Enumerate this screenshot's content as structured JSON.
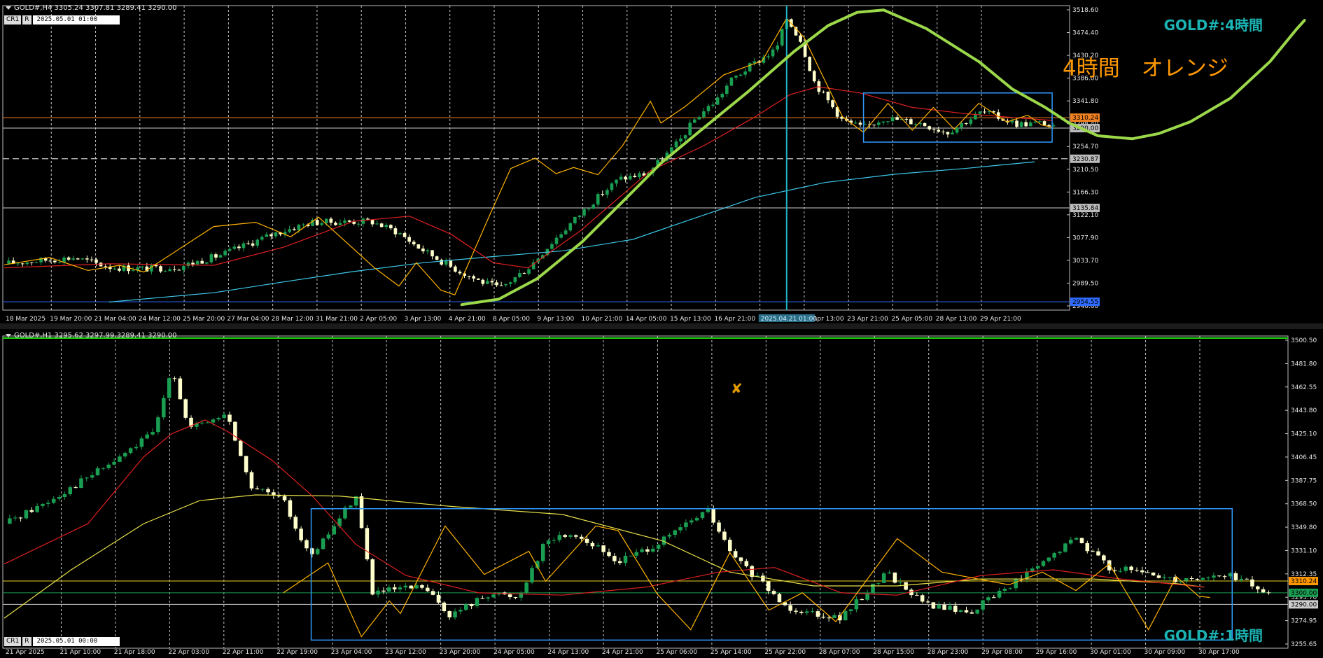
{
  "top": {
    "header": "GOLD#,H4  3305.24 3307.81 3289.41 3290.00",
    "mode": {
      "cr": "CR1",
      "r": "R",
      "date": "2025.05.01 01:00"
    },
    "panel_title": "GOLD#:4時間",
    "annotation": "4時間　オレンジ",
    "cursor_label": "2025.04.21 01:00"
  },
  "bottom": {
    "header": "GOLD#,H1  3295.62 3297.99 3289.41 3290.00",
    "mode": {
      "cr": "CR1",
      "r": "R",
      "date": "2025.05.01 00:00"
    },
    "panel_title": "GOLD#:1時間"
  },
  "colors": {
    "bull": "#1a9e52",
    "bear": "#ffffcc",
    "ma_red": "#e02020",
    "ma_cyan": "#3dc8ea",
    "ma_yellow": "#e9e14a",
    "zigzag": "#ffb300",
    "box": "#2f9bff",
    "curve": "#9bd84a",
    "cursor": "#20b4c8"
  },
  "chart_data": [
    {
      "type": "candlestick",
      "title": "GOLD#,H4",
      "ylim": [
        2946.6,
        3518.6
      ],
      "y_ticks": [
        "3518.60",
        "3474.40",
        "3430.20",
        "3386.00",
        "3341.80",
        "3298.40",
        "3254.70",
        "3210.50",
        "3166.30",
        "3122.10",
        "3077.90",
        "3033.70",
        "2989.50",
        "2946.60"
      ],
      "x_ticks": [
        "18 Mar 2025",
        "19 Mar 20:00",
        "21 Mar 04:00",
        "24 Mar 12:00",
        "25 Mar 20:00",
        "27 Mar 04:00",
        "28 Mar 12:00",
        "31 Mar 21:00",
        "2 Apr 05:00",
        "3 Apr 13:00",
        "4 Apr 21:00",
        "8 Apr 05:00",
        "9 Apr 13:00",
        "10 Apr 21:00",
        "14 Apr 05:00",
        "15 Apr 13:00",
        "16 Apr 21:00",
        "05:00",
        "22 Apr 13:00",
        "23 Apr 21:00",
        "25 Apr 05:00",
        "28 Apr 13:00",
        "29 Apr 21:00"
      ],
      "bars": 228,
      "price_path": [
        [
          0,
          3028
        ],
        [
          20,
          3040
        ],
        [
          30,
          3022
        ],
        [
          40,
          3018
        ],
        [
          50,
          3022
        ],
        [
          62,
          3045
        ],
        [
          78,
          3088
        ],
        [
          88,
          3108
        ],
        [
          105,
          3110
        ],
        [
          113,
          3088
        ],
        [
          118,
          3062
        ],
        [
          128,
          3022
        ],
        [
          136,
          2995
        ],
        [
          142,
          2980
        ],
        [
          150,
          3020
        ],
        [
          158,
          3078
        ],
        [
          168,
          3145
        ],
        [
          176,
          3192
        ],
        [
          184,
          3202
        ],
        [
          193,
          3262
        ],
        [
          198,
          3310
        ],
        [
          204,
          3345
        ],
        [
          208,
          3382
        ],
        [
          214,
          3412
        ],
        [
          221,
          3442
        ],
        [
          224,
          3502
        ],
        [
          228,
          3460
        ],
        [
          232,
          3378
        ],
        [
          240,
          3305
        ],
        [
          246,
          3290
        ],
        [
          252,
          3310
        ],
        [
          262,
          3300
        ],
        [
          270,
          3282
        ],
        [
          280,
          3322
        ],
        [
          290,
          3298
        ],
        [
          298,
          3300
        ],
        [
          300,
          3290
        ]
      ],
      "zigzag": [
        [
          0,
          3026
        ],
        [
          13,
          3040
        ],
        [
          24,
          3015
        ],
        [
          33,
          3025
        ],
        [
          40,
          3012
        ],
        [
          60,
          3100
        ],
        [
          72,
          3108
        ],
        [
          82,
          3080
        ],
        [
          90,
          3118
        ],
        [
          106,
          3020
        ],
        [
          113,
          2985
        ],
        [
          118,
          3030
        ],
        [
          125,
          2977
        ],
        [
          129,
          2968
        ],
        [
          139,
          3122
        ],
        [
          145,
          3212
        ],
        [
          152,
          3232
        ],
        [
          158,
          3202
        ],
        [
          163,
          3214
        ],
        [
          170,
          3200
        ],
        [
          177,
          3256
        ],
        [
          185,
          3342
        ],
        [
          188,
          3300
        ],
        [
          195,
          3332
        ],
        [
          206,
          3393
        ],
        [
          217,
          3420
        ],
        [
          224,
          3502
        ],
        [
          229,
          3465
        ],
        [
          240,
          3312
        ],
        [
          246,
          3282
        ],
        [
          253,
          3338
        ],
        [
          260,
          3286
        ],
        [
          266,
          3330
        ],
        [
          272,
          3288
        ],
        [
          279,
          3338
        ],
        [
          287,
          3302
        ],
        [
          293,
          3315
        ],
        [
          297,
          3296
        ],
        [
          300,
          3292
        ]
      ],
      "ma_red": [
        [
          0,
          3020
        ],
        [
          30,
          3028
        ],
        [
          60,
          3025
        ],
        [
          80,
          3060
        ],
        [
          100,
          3110
        ],
        [
          116,
          3120
        ],
        [
          128,
          3085
        ],
        [
          140,
          3030
        ],
        [
          150,
          3020
        ],
        [
          165,
          3092
        ],
        [
          185,
          3208
        ],
        [
          200,
          3255
        ],
        [
          215,
          3312
        ],
        [
          225,
          3355
        ],
        [
          233,
          3370
        ],
        [
          245,
          3358
        ],
        [
          260,
          3330
        ],
        [
          275,
          3318
        ],
        [
          290,
          3310
        ],
        [
          300,
          3305
        ]
      ],
      "ma_cyan": [
        [
          30,
          2954
        ],
        [
          60,
          2972
        ],
        [
          80,
          2993
        ],
        [
          100,
          3013
        ],
        [
          120,
          3030
        ],
        [
          140,
          3042
        ],
        [
          160,
          3053
        ],
        [
          180,
          3075
        ],
        [
          195,
          3110
        ],
        [
          215,
          3156
        ],
        [
          235,
          3185
        ],
        [
          255,
          3201
        ],
        [
          275,
          3212
        ],
        [
          295,
          3225
        ]
      ],
      "h_lines": [
        {
          "v": 3310.24,
          "color": "#f08020",
          "label": "3310.24",
          "bg": "#f08020"
        },
        {
          "v": 3290.0,
          "color": "#cccccc",
          "label": "3290.00",
          "bg": "#bbbbbb"
        },
        {
          "v": 3230.87,
          "color": "#cccccc",
          "label": "3230.87",
          "dash": true,
          "bg": "#bbbbbb"
        },
        {
          "v": 3135.84,
          "color": "#cccccc",
          "label": "3135.84",
          "bg": "#bbbbbb"
        },
        {
          "v": 2954.55,
          "color": "#2f6bff",
          "label": "2954.55",
          "bg": "#2f6bff"
        }
      ],
      "box": {
        "t0": 246,
        "t1": 300,
        "p_top": 3358,
        "p_bot": 3263
      },
      "green_curve": [
        [
          0.349,
          0.942
        ],
        [
          0.377,
          0.925
        ],
        [
          0.406,
          0.862
        ],
        [
          0.44,
          0.748
        ],
        [
          0.472,
          0.618
        ],
        [
          0.5,
          0.503
        ],
        [
          0.53,
          0.402
        ],
        [
          0.565,
          0.285
        ],
        [
          0.6,
          0.16
        ],
        [
          0.626,
          0.079
        ],
        [
          0.648,
          0.038
        ],
        [
          0.668,
          0.031
        ],
        [
          0.7,
          0.088
        ],
        [
          0.74,
          0.191
        ],
        [
          0.765,
          0.275
        ],
        [
          0.79,
          0.332
        ],
        [
          0.808,
          0.38
        ],
        [
          0.83,
          0.42
        ],
        [
          0.856,
          0.429
        ],
        [
          0.876,
          0.413
        ],
        [
          0.9,
          0.376
        ],
        [
          0.93,
          0.304
        ],
        [
          0.96,
          0.19
        ],
        [
          0.98,
          0.09
        ],
        [
          0.986,
          0.063
        ]
      ],
      "cursor_t": 224
    },
    {
      "type": "candlestick",
      "title": "GOLD#,H1",
      "ylim": [
        3255.6,
        3519.2
      ],
      "y_ticks": [
        "3500.50",
        "3481.80",
        "3462.55",
        "3443.80",
        "3425.10",
        "3406.45",
        "3387.75",
        "3368.50",
        "3349.80",
        "3331.10",
        "3312.35",
        "3293.70",
        "3274.95",
        "3255.65"
      ],
      "x_ticks": [
        "21 Apr 2025",
        "21 Apr 10:00",
        "21 Apr 18:00",
        "22 Apr 03:00",
        "22 Apr 11:00",
        "22 Apr 19:00",
        "23 Apr 04:00",
        "23 Apr 12:00",
        "23 Apr 20:00",
        "24 Apr 05:00",
        "24 Apr 13:00",
        "24 Apr 21:00",
        "25 Apr 06:00",
        "25 Apr 14:00",
        "25 Apr 22:00",
        "28 Apr 07:00",
        "28 Apr 15:00",
        "28 Apr 23:00",
        "29 Apr 08:00",
        "29 Apr 16:00",
        "30 Apr 01:00",
        "30 Apr 09:00",
        "30 Apr 17:00"
      ],
      "bars": 230,
      "price_path": [
        [
          0,
          3360
        ],
        [
          8,
          3380
        ],
        [
          20,
          3415
        ],
        [
          27,
          3440
        ],
        [
          30,
          3498
        ],
        [
          33,
          3442
        ],
        [
          40,
          3455
        ],
        [
          44,
          3393
        ],
        [
          50,
          3380
        ],
        [
          55,
          3330
        ],
        [
          63,
          3385
        ],
        [
          66,
          3300
        ],
        [
          75,
          3305
        ],
        [
          80,
          3280
        ],
        [
          87,
          3300
        ],
        [
          92,
          3296
        ],
        [
          97,
          3345
        ],
        [
          102,
          3352
        ],
        [
          110,
          3327
        ],
        [
          118,
          3345
        ],
        [
          126,
          3372
        ],
        [
          130,
          3335
        ],
        [
          140,
          3288
        ],
        [
          150,
          3278
        ],
        [
          158,
          3318
        ],
        [
          165,
          3290
        ],
        [
          173,
          3283
        ],
        [
          178,
          3300
        ],
        [
          186,
          3325
        ],
        [
          192,
          3348
        ],
        [
          198,
          3322
        ],
        [
          210,
          3312
        ],
        [
          220,
          3315
        ],
        [
          230,
          3290
        ]
      ],
      "zigzag": [
        [
          50,
          3300
        ],
        [
          58,
          3326
        ],
        [
          64,
          3262
        ],
        [
          69,
          3293
        ],
        [
          71,
          3282
        ],
        [
          79,
          3358
        ],
        [
          86,
          3316
        ],
        [
          94,
          3336
        ],
        [
          97,
          3310
        ],
        [
          106,
          3358
        ],
        [
          110,
          3354
        ],
        [
          117,
          3299
        ],
        [
          123,
          3268
        ],
        [
          130,
          3335
        ],
        [
          137,
          3285
        ],
        [
          143,
          3300
        ],
        [
          149,
          3275
        ],
        [
          160,
          3347
        ],
        [
          168,
          3318
        ],
        [
          180,
          3307
        ],
        [
          186,
          3318
        ],
        [
          192,
          3302
        ],
        [
          198,
          3325
        ],
        [
          205,
          3268
        ],
        [
          210,
          3314
        ],
        [
          214,
          3297
        ],
        [
          216,
          3296
        ]
      ],
      "ma_red": [
        [
          0,
          3325
        ],
        [
          15,
          3360
        ],
        [
          25,
          3418
        ],
        [
          30,
          3438
        ],
        [
          36,
          3450
        ],
        [
          40,
          3440
        ],
        [
          48,
          3415
        ],
        [
          55,
          3385
        ],
        [
          63,
          3342
        ],
        [
          72,
          3315
        ],
        [
          85,
          3300
        ],
        [
          100,
          3298
        ],
        [
          115,
          3305
        ],
        [
          128,
          3318
        ],
        [
          138,
          3322
        ],
        [
          150,
          3300
        ],
        [
          160,
          3298
        ],
        [
          175,
          3315
        ],
        [
          188,
          3320
        ],
        [
          200,
          3312
        ],
        [
          215,
          3305
        ]
      ],
      "ma_yellow": [
        [
          0,
          3278
        ],
        [
          12,
          3320
        ],
        [
          25,
          3360
        ],
        [
          35,
          3380
        ],
        [
          45,
          3385
        ],
        [
          60,
          3384
        ],
        [
          80,
          3375
        ],
        [
          100,
          3368
        ],
        [
          118,
          3345
        ],
        [
          130,
          3318
        ],
        [
          145,
          3306
        ],
        [
          160,
          3306
        ],
        [
          175,
          3312
        ],
        [
          195,
          3312
        ],
        [
          210,
          3308
        ],
        [
          215,
          3305
        ]
      ],
      "h_lines": [
        {
          "v": 3310.24,
          "color": "#e6d020",
          "label": "3310.24",
          "bg": "#ff9800"
        },
        {
          "v": 3300.0,
          "color": "#1a9e52",
          "label": "3300.00",
          "bg": "#1a9e52"
        },
        {
          "v": 3290.0,
          "color": "#cccccc",
          "label": "3290.00",
          "bg": "#cccccc"
        }
      ],
      "box": {
        "t0": 55,
        "t1": 220,
        "p_top": 3373,
        "p_bot": 3259
      },
      "cross_t": 145
    }
  ]
}
